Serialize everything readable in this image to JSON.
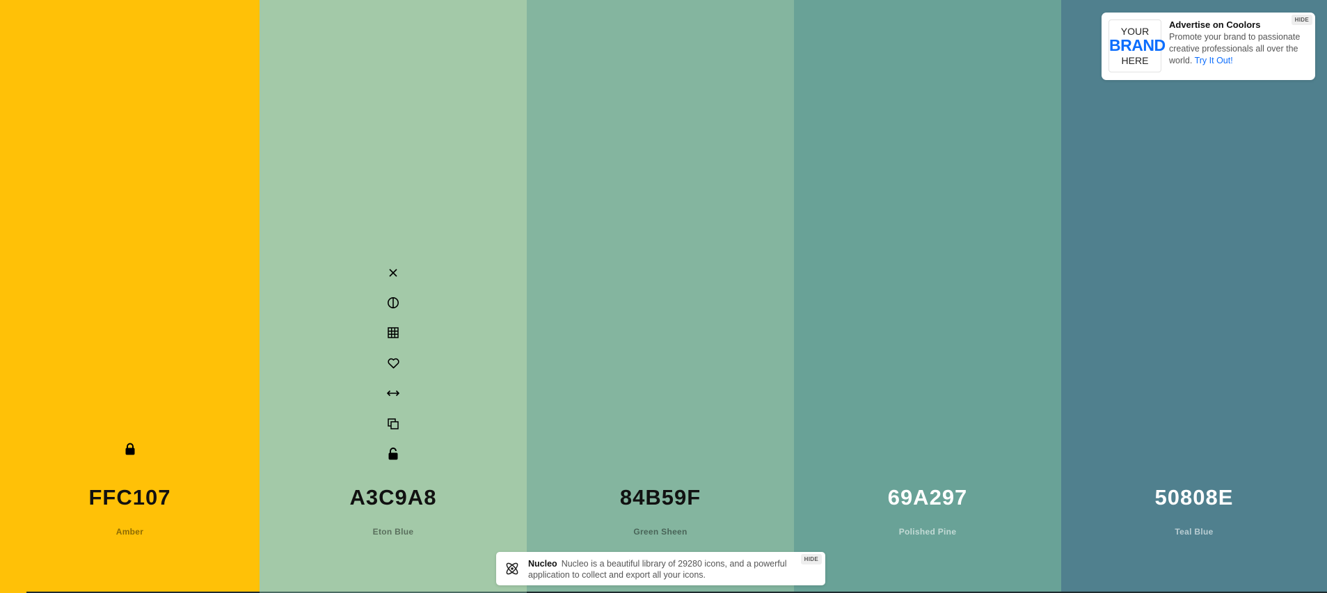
{
  "palette": {
    "colors": [
      {
        "hex": "FFC107",
        "name": "Amber",
        "bg": "#FFC107"
      },
      {
        "hex": "A3C9A8",
        "name": "Eton Blue",
        "bg": "#A3C9A8"
      },
      {
        "hex": "84B59F",
        "name": "Green Sheen",
        "bg": "#84B59F"
      },
      {
        "hex": "69A297",
        "name": "Polished Pine",
        "bg": "#69A297"
      },
      {
        "hex": "50808E",
        "name": "Teal Blue",
        "bg": "#50808E"
      }
    ],
    "column_tools": [
      "close-icon",
      "contrast-icon",
      "shades-grid-icon",
      "heart-icon",
      "drag-arrows-icon",
      "copy-icon",
      "unlock-icon"
    ],
    "locked_column_icon": "lock-icon"
  },
  "ad": {
    "logo_line1": "YOUR",
    "logo_line2": "BRAND",
    "logo_line3": "HERE",
    "title": "Advertise on Coolors",
    "body": "Promote your brand to passionate creative professionals all over the world.",
    "link": "Try It Out!",
    "hide_label": "HIDE"
  },
  "banner": {
    "brand": "Nucleo",
    "text": "Nucleo is a beautiful library of 29280 icons, and a powerful application to collect and export all your icons.",
    "hide_label": "HIDE"
  },
  "colors": {
    "ad_link": "#0d6efd",
    "dark_text": "#111111",
    "light_text": "#ffffff"
  }
}
